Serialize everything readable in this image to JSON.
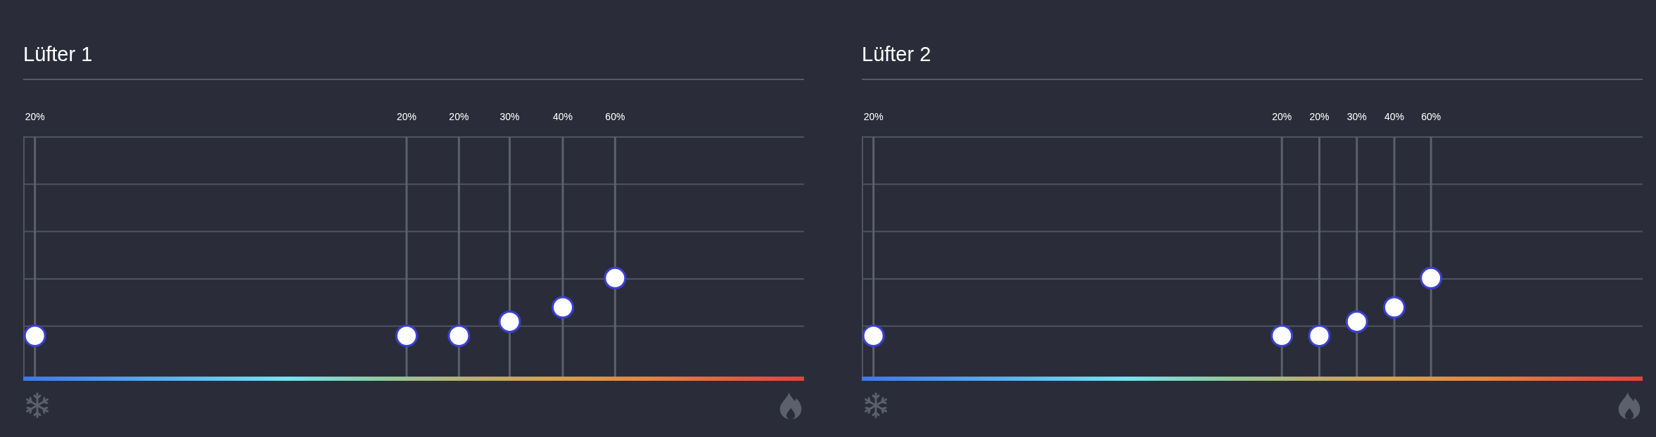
{
  "panels": [
    {
      "title": "Lüfter 1",
      "points": [
        {
          "label": "20%",
          "temperature": {
            "level": 0.015
          },
          "speed": {
            "level": 0.17
          }
        },
        {
          "label": "20%",
          "temperature": {
            "level": 0.491
          },
          "speed": {
            "level": 0.17
          }
        },
        {
          "label": "20%",
          "temperature": {
            "level": 0.558
          },
          "speed": {
            "level": 0.17
          }
        },
        {
          "label": "30%",
          "temperature": {
            "level": 0.623
          },
          "speed": {
            "level": 0.229
          }
        },
        {
          "label": "40%",
          "temperature": {
            "level": 0.691
          },
          "speed": {
            "level": 0.289
          }
        },
        {
          "label": "60%",
          "temperature": {
            "level": 0.758
          },
          "speed": {
            "level": 0.411
          }
        }
      ]
    },
    {
      "title": "Lüfter 2",
      "points": [
        {
          "label": "20%",
          "temperature": {
            "level": 0.015
          },
          "speed": {
            "level": 0.17
          }
        },
        {
          "label": "20%",
          "temperature": {
            "level": 0.538
          },
          "speed": {
            "level": 0.17
          }
        },
        {
          "label": "20%",
          "temperature": {
            "level": 0.586
          },
          "speed": {
            "level": 0.17
          }
        },
        {
          "label": "30%",
          "temperature": {
            "level": 0.634
          },
          "speed": {
            "level": 0.229
          }
        },
        {
          "label": "40%",
          "temperature": {
            "level": 0.682
          },
          "speed": {
            "level": 0.289
          }
        },
        {
          "label": "60%",
          "temperature": {
            "level": 0.729
          },
          "speed": {
            "level": 0.411
          }
        }
      ]
    }
  ]
}
